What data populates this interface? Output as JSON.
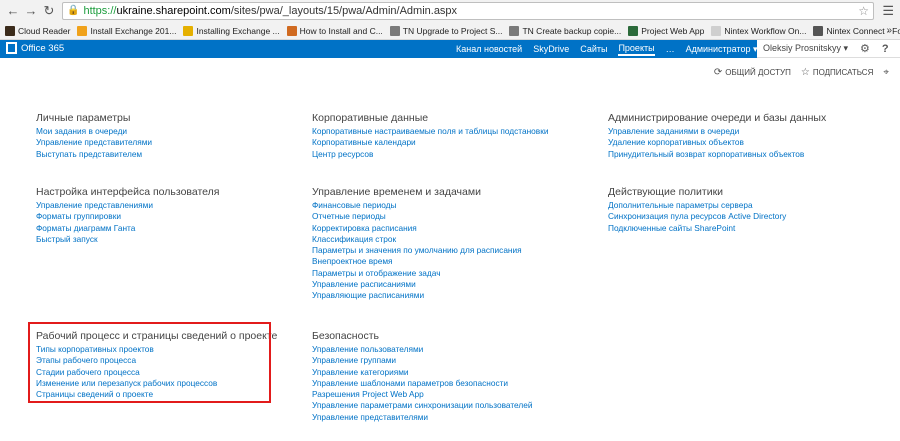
{
  "browser": {
    "url_scheme": "https://",
    "url_host": "ukraine.sharepoint.com",
    "url_path": "/sites/pwa/_layouts/15/pwa/Admin/Admin.aspx",
    "bookmarks": [
      {
        "label": "Cloud Reader",
        "color": "#3b2b1b"
      },
      {
        "label": "Install Exchange 201...",
        "color": "#f0a21b"
      },
      {
        "label": "Installing Exchange ...",
        "color": "#e5b000"
      },
      {
        "label": "How to Install and C...",
        "color": "#d06a20"
      },
      {
        "label": "TN Upgrade to Project S...",
        "color": "#7a7a7a"
      },
      {
        "label": "TN Create backup copie...",
        "color": "#7a7a7a"
      },
      {
        "label": "Project Web App",
        "color": "#2b6a3a"
      },
      {
        "label": "Nintex Workflow On...",
        "color": "#cfcfcf"
      },
      {
        "label": "Nintex Connect - Fo...",
        "color": "#555555"
      }
    ],
    "more": "»"
  },
  "suite": {
    "brand": "Office 365",
    "links": [
      "Канал новостей",
      "SkyDrive",
      "Сайты",
      "Проекты",
      "…",
      "Администратор ▾"
    ],
    "user": "Oleksiy Prosnitskyy ▾"
  },
  "actions": {
    "share": "ОБЩИЙ ДОСТУП",
    "follow": "ПОДПИСАТЬСЯ"
  },
  "sections": [
    {
      "title": "Личные параметры",
      "links": [
        "Мои задания в очереди",
        "Управление представителями",
        "Выступать представителем"
      ]
    },
    {
      "title": "Корпоративные данные",
      "links": [
        "Корпоративные настраиваемые поля и таблицы подстановки",
        "Корпоративные календари",
        "Центр ресурсов"
      ]
    },
    {
      "title": "Администрирование очереди и базы данных",
      "links": [
        "Управление заданиями в очереди",
        "Удаление корпоративных объектов",
        "Принудительный возврат корпоративных объектов"
      ]
    },
    {
      "title": "Настройка интерфейса пользователя",
      "links": [
        "Управление представлениями",
        "Форматы группировки",
        "Форматы диаграмм Ганта",
        "Быстрый запуск"
      ]
    },
    {
      "title": "Управление временем и задачами",
      "links": [
        "Финансовые периоды",
        "Отчетные периоды",
        "Корректировка расписания",
        "Классификация строк",
        "Параметры и значения по умолчанию для расписания",
        "Внепроектное время",
        "Параметры и отображение задач",
        "Управление расписаниями",
        "Управляющие расписаниями"
      ]
    },
    {
      "title": "Действующие политики",
      "links": [
        "Дополнительные параметры сервера",
        "Синхронизация пула ресурсов Active Directory",
        "Подключенные сайты SharePoint"
      ]
    },
    {
      "title": "Рабочий процесс и страницы сведений о проекте",
      "links": [
        "Типы корпоративных проектов",
        "Этапы рабочего процесса",
        "Стадии рабочего процесса",
        "Изменение или перезапуск рабочих процессов",
        "Страницы сведений о проекте"
      ]
    },
    {
      "title": "Безопасность",
      "links": [
        "Управление пользователями",
        "Управление группами",
        "Управление категориями",
        "Управление шаблонами параметров безопасности",
        "Разрешения Project Web App",
        "Управление параметрами синхронизации пользователей",
        "Управление представителями"
      ]
    }
  ]
}
